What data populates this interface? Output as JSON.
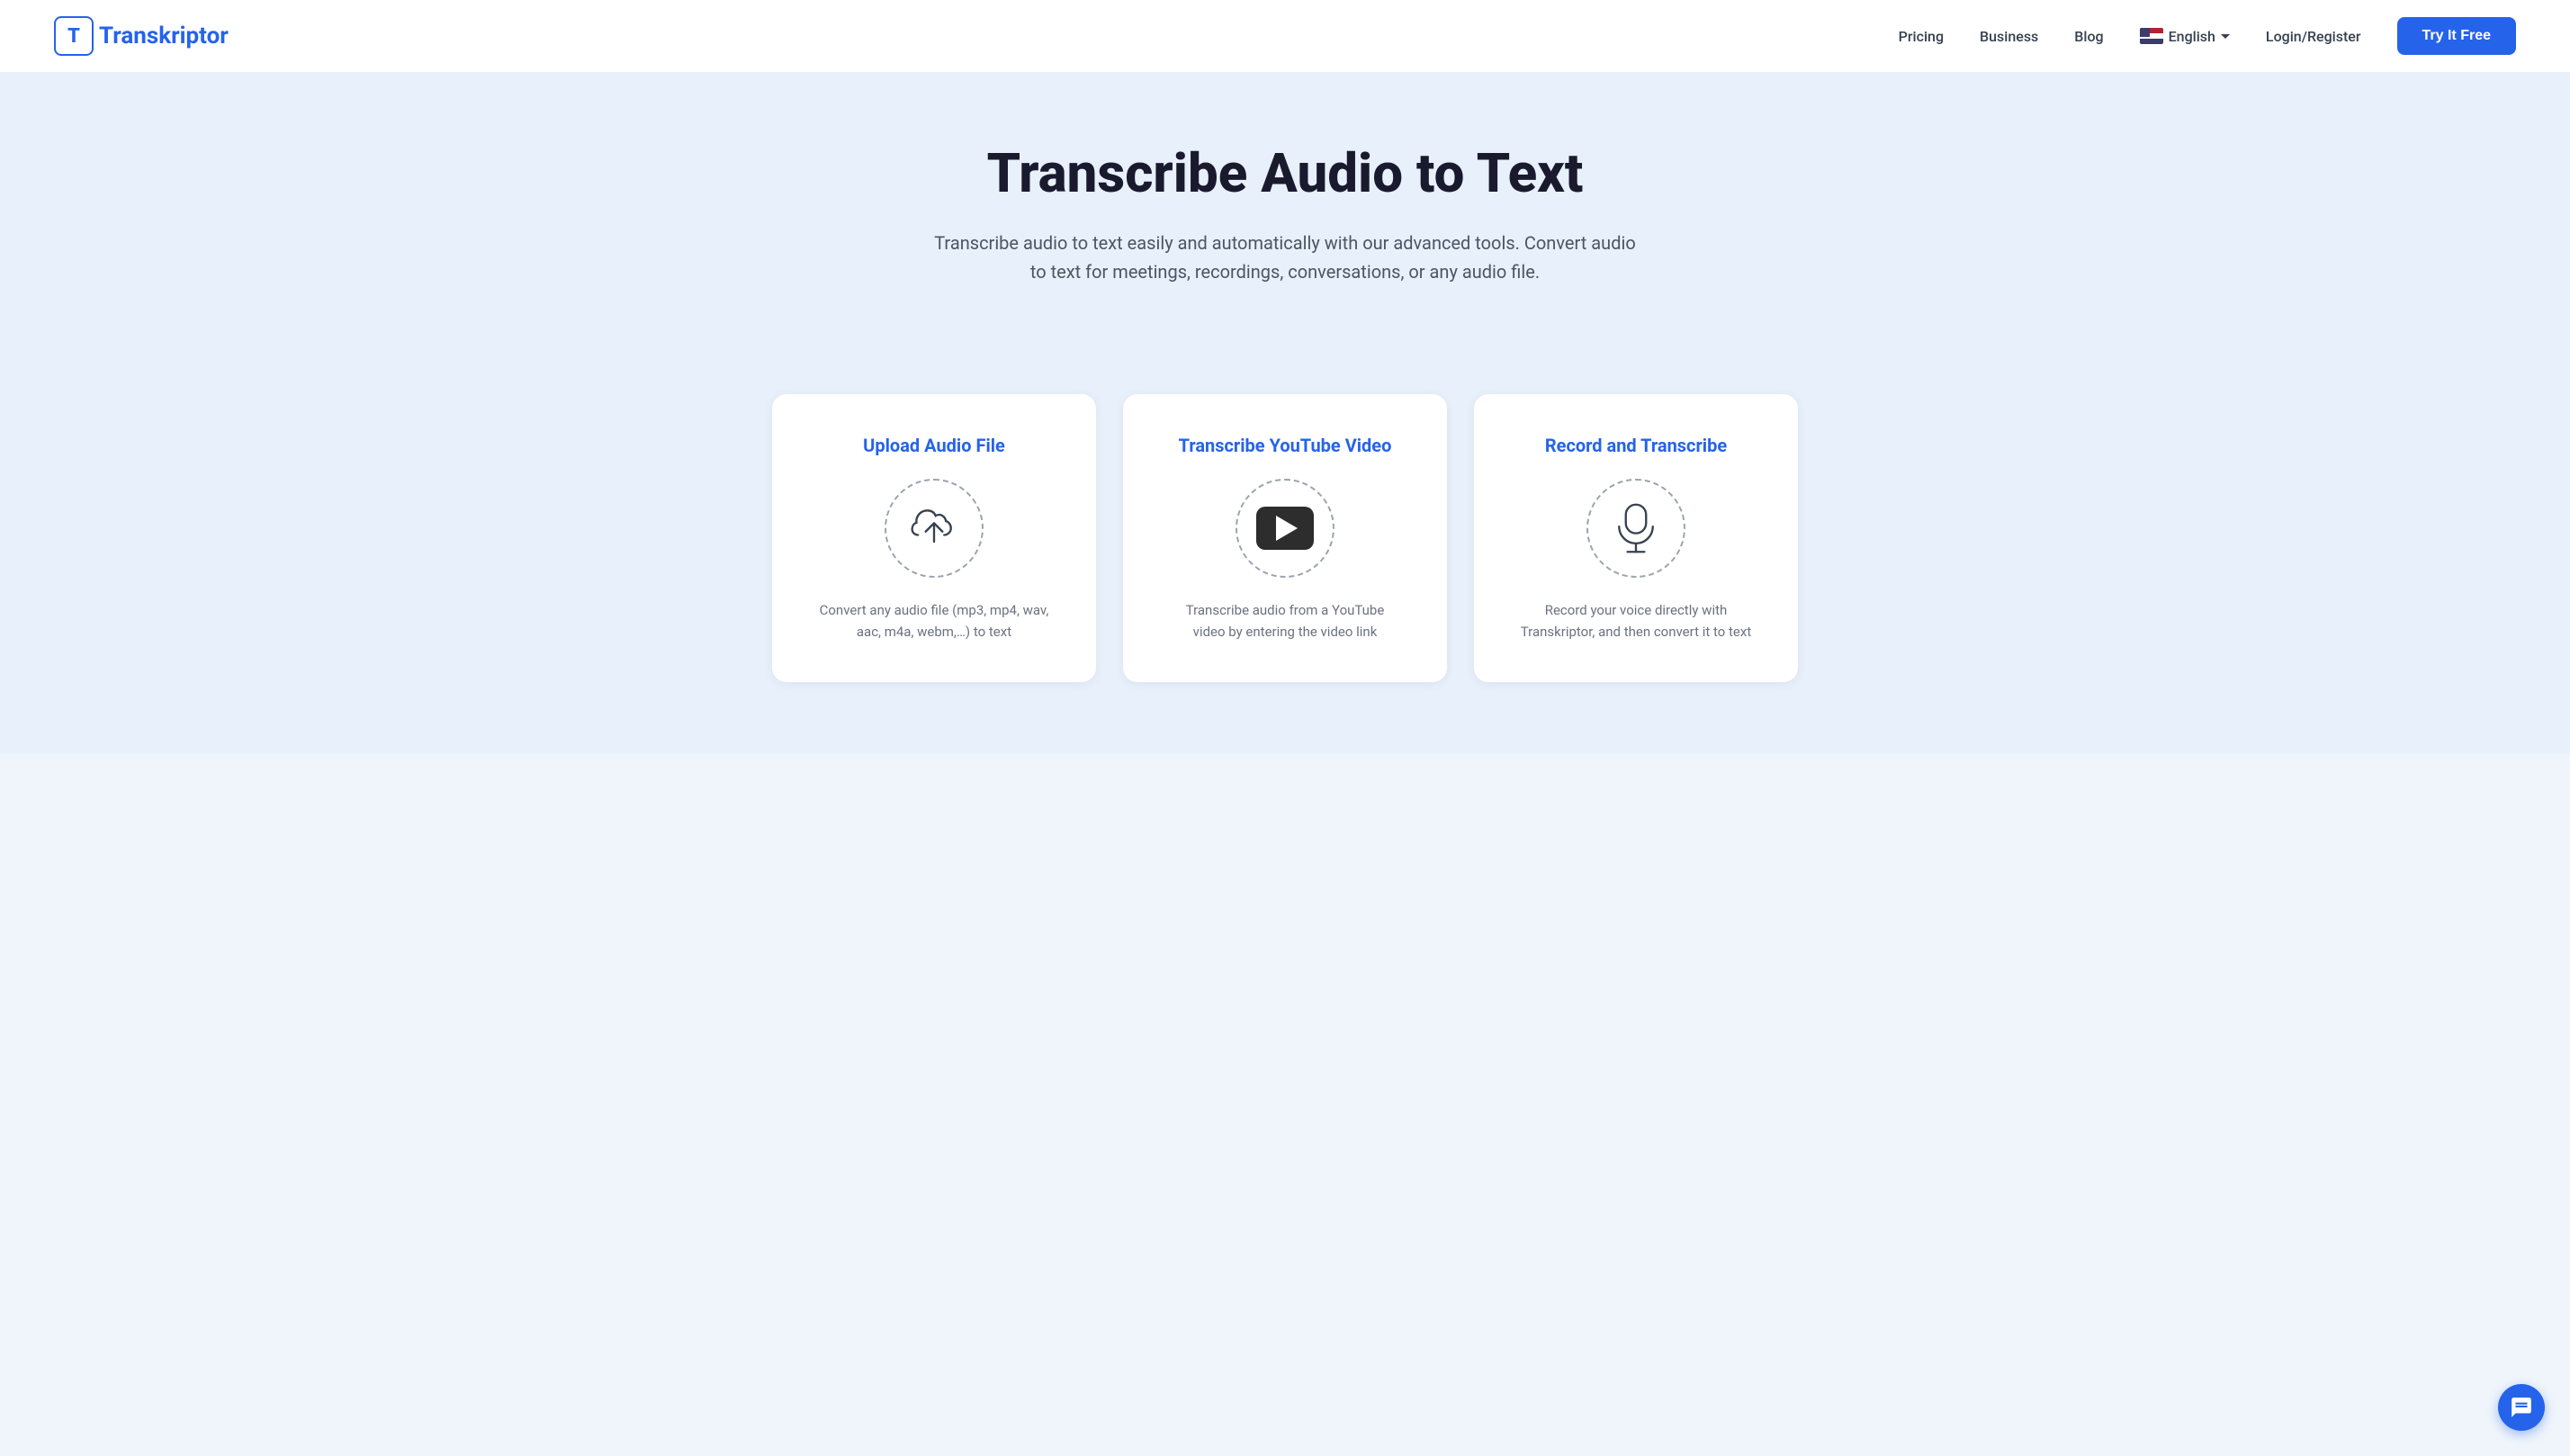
{
  "navbar": {
    "logo_letter": "T",
    "logo_name_prefix": "",
    "logo_name": "ranskriptor",
    "nav_links": [
      {
        "id": "pricing",
        "label": "Pricing"
      },
      {
        "id": "business",
        "label": "Business"
      },
      {
        "id": "blog",
        "label": "Blog"
      }
    ],
    "language": {
      "label": "English",
      "chevron": "▾"
    },
    "login_label": "Login/Register",
    "try_free_label": "Try It Free"
  },
  "hero": {
    "title": "Transcribe Audio to Text",
    "subtitle": "Transcribe audio to text easily and automatically with our advanced tools. Convert audio to text for meetings, recordings, conversations, or any audio file."
  },
  "cards": [
    {
      "id": "upload-audio",
      "title": "Upload Audio File",
      "icon_type": "upload",
      "description": "Convert any audio file (mp3, mp4, wav, aac, m4a, webm,…) to text"
    },
    {
      "id": "transcribe-youtube",
      "title": "Transcribe YouTube Video",
      "icon_type": "youtube",
      "description": "Transcribe audio from a YouTube video by entering the video link"
    },
    {
      "id": "record-transcribe",
      "title": "Record and Transcribe",
      "icon_type": "microphone",
      "description": "Record your voice directly with Transkriptor, and then convert it to text"
    }
  ],
  "chat": {
    "label": "Chat support"
  }
}
